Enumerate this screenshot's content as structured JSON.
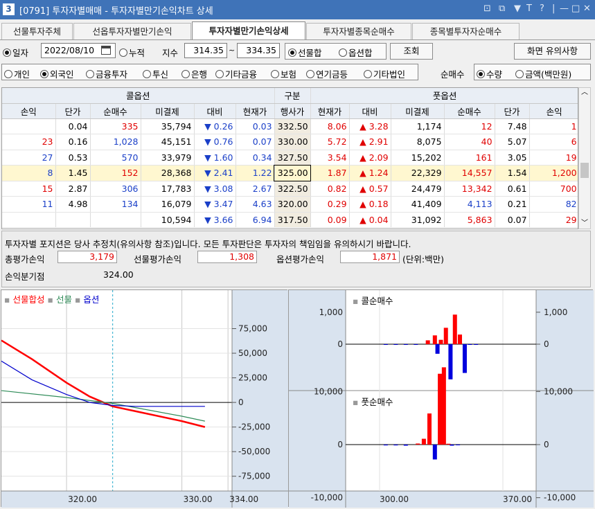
{
  "window": {
    "number": "3",
    "title": "[0791] 투자자별매매 - 투자자별만기손익차트 상세",
    "controls": [
      "⊡",
      "⧉",
      "▼",
      "T",
      "?",
      "|",
      "—",
      "□",
      "✕"
    ]
  },
  "tabs": [
    "선물투자주체",
    "선옵투자자별만기손익",
    "투자자별만기손익상세",
    "투자자별종목순매수",
    "종목별투자자순매수"
  ],
  "active_tab": 2,
  "filter": {
    "date_label": "일자",
    "date_value": "2022/08/10",
    "cumulative_label": "누적",
    "index_label": "지수",
    "index_from": "314.35",
    "tilde": "~",
    "index_to": "334.35",
    "futures_sum_label": "선물합",
    "options_sum_label": "옵션합",
    "query_button": "조회",
    "notice_button": "화면 유의사항"
  },
  "investors": [
    "개인",
    "외국인",
    "금융투자",
    "투신",
    "은행",
    "기타금융",
    "보험",
    "연기금등",
    "기타법인"
  ],
  "selected_investor": 1,
  "net_buy": {
    "label": "순매수",
    "qty_label": "수량",
    "amount_label": "금액(백만원)"
  },
  "grid": {
    "call_header": "콜옵션",
    "mid_header": "구분",
    "put_header": "풋옵션",
    "columns": [
      "손익",
      "단가",
      "순매수",
      "미결제",
      "대비",
      "현재가",
      "행사가",
      "현재가",
      "대비",
      "미결제",
      "순매수",
      "단가",
      "손익"
    ],
    "rows": [
      [
        "",
        "0.04",
        "335",
        "35,794",
        "▼ 0.26",
        "0.03",
        "332.50",
        "8.06",
        "▲ 3.28",
        "1,174",
        "12",
        "7.48",
        "1"
      ],
      [
        "23",
        "0.16",
        "1,028",
        "45,151",
        "▼ 0.76",
        "0.07",
        "330.00",
        "5.72",
        "▲ 2.91",
        "8,075",
        "40",
        "5.07",
        "6"
      ],
      [
        "27",
        "0.53",
        "570",
        "33,979",
        "▼ 1.60",
        "0.34",
        "327.50",
        "3.54",
        "▲ 2.09",
        "15,202",
        "161",
        "3.05",
        "19"
      ],
      [
        "8",
        "1.45",
        "152",
        "28,368",
        "▼ 2.41",
        "1.22",
        "325.00",
        "1.87",
        "▲ 1.24",
        "22,329",
        "14,557",
        "1.54",
        "1,200"
      ],
      [
        "15",
        "2.87",
        "306",
        "17,783",
        "▼ 3.08",
        "2.67",
        "322.50",
        "0.82",
        "▲ 0.57",
        "24,479",
        "13,342",
        "0.61",
        "700"
      ],
      [
        "11",
        "4.98",
        "134",
        "16,079",
        "▼ 3.47",
        "4.63",
        "320.00",
        "0.29",
        "▲ 0.18",
        "41,409",
        "4,113",
        "0.21",
        "82"
      ],
      [
        "",
        "",
        "",
        "10,594",
        "▼ 3.66",
        "6.94",
        "317.50",
        "0.09",
        "▲ 0.04",
        "31,092",
        "5,863",
        "0.07",
        "29"
      ]
    ],
    "highlight_row": 3
  },
  "info": {
    "notice": "투자자별 포지션은 당사 추정치(유의사항 참조)입니다. 모든 투자판단은 투자자의 책임임을 유의하시기 바랍니다.",
    "total_label": "총평가손익",
    "total_value": "3,179",
    "fut_label": "선물평가손익",
    "fut_value": "1,308",
    "opt_label": "옵션평가손익",
    "opt_value": "1,871",
    "unit": "(단위:백만)",
    "bep_label": "손익분기점",
    "bep_value": "324.00"
  },
  "colors": {
    "futures_sum": "#ff0000",
    "futures": "#2e8b57",
    "options": "#0000cc",
    "call_bar_pos": "#ff0000",
    "call_bar_neg": "#0000dd"
  },
  "chart_data": [
    {
      "type": "line",
      "legend": [
        "선물합성",
        "선물",
        "옵션"
      ],
      "x_ticks": [
        "320.00",
        "330.00",
        "334.00"
      ],
      "y_ticks": [
        "75,000",
        "50,000",
        "25,000",
        "0",
        "-25,000",
        "-50,000",
        "-75,000"
      ],
      "ylim": [
        -90000,
        100000
      ],
      "xlim": [
        314.35,
        334.35
      ],
      "series": [
        {
          "name": "선물합성",
          "x": [
            314.35,
            317,
            320,
            322,
            324,
            326,
            330,
            332
          ],
          "y": [
            63000,
            44000,
            20000,
            6000,
            -4000,
            -9000,
            -19000,
            -25000
          ]
        },
        {
          "name": "선물",
          "x": [
            314.35,
            320,
            324,
            330,
            332
          ],
          "y": [
            12000,
            5000,
            -1000,
            -14000,
            -19000
          ]
        },
        {
          "name": "옵션",
          "x": [
            314.35,
            317,
            320,
            322,
            324,
            326,
            330,
            332
          ],
          "y": [
            42000,
            23000,
            8000,
            0,
            -3000,
            -4000,
            -4000,
            -4000
          ]
        }
      ]
    },
    {
      "type": "bar",
      "title": "콜순매수",
      "y_ticks": [
        "1,000",
        "0"
      ],
      "x_ticks": [
        "300.00",
        "370.00"
      ],
      "ylim": [
        -1300,
        1300
      ],
      "x": [
        300,
        305,
        310,
        315,
        317.5,
        320,
        322.5,
        325,
        327.5,
        330,
        332.5,
        335,
        340
      ],
      "values": [
        -10,
        -10,
        -10,
        -10,
        134,
        306,
        152,
        570,
        1028,
        335,
        -10,
        -8,
        0
      ],
      "neg_values": [
        0,
        0,
        0,
        0,
        0,
        0,
        -900,
        0,
        0,
        0,
        0,
        0,
        0
      ]
    },
    {
      "type": "bar",
      "title": "풋순매수",
      "y_ticks": [
        "10,000",
        "0",
        "-10,000"
      ],
      "x_ticks": [
        "300.00",
        "370.00"
      ],
      "ylim": [
        -15000,
        18000
      ],
      "x": [
        300,
        305,
        310,
        315,
        317.5,
        320,
        322.5,
        325,
        327.5,
        330,
        332.5
      ],
      "values": [
        0,
        -200,
        0,
        200,
        5863,
        4113,
        13342,
        14557,
        161,
        40,
        12
      ]
    }
  ]
}
